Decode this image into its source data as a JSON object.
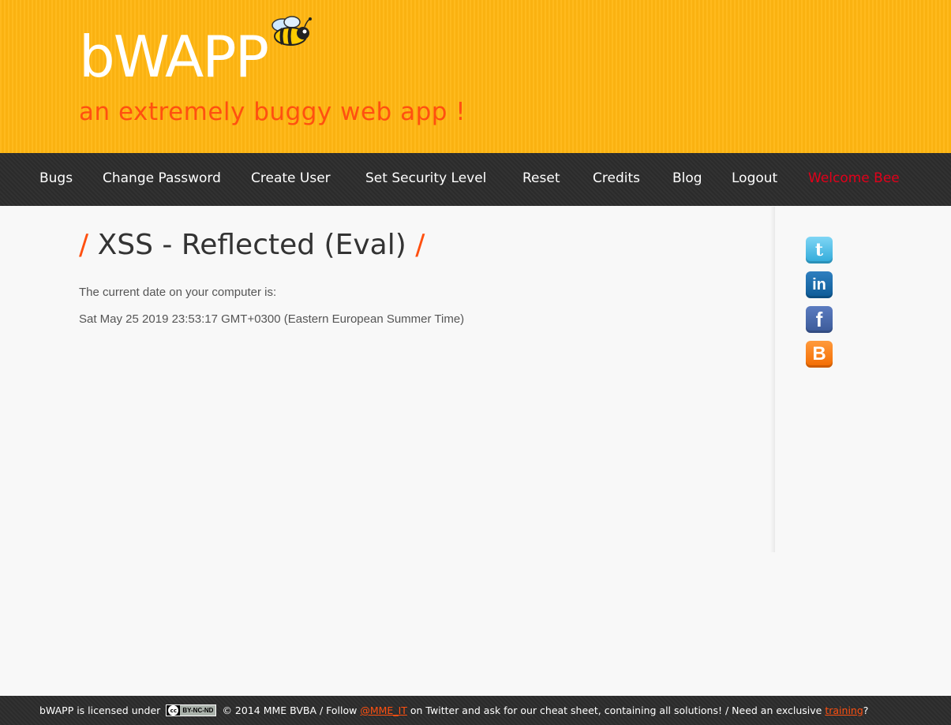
{
  "header": {
    "logo": "bWAPP",
    "tagline": "an extremely buggy web app !"
  },
  "nav": {
    "items": [
      "Bugs",
      "Change Password",
      "Create User",
      "Set Security Level",
      "Reset",
      "Credits",
      "Blog",
      "Logout",
      "Welcome Bee"
    ]
  },
  "main": {
    "title_slash_left": "/",
    "title": "XSS - Reflected (Eval)",
    "title_slash_right": "/",
    "line1": "The current date on your computer is:",
    "line2": "Sat May 25 2019 23:53:17 GMT+0300 (Eastern European Summer Time)"
  },
  "social": {
    "icons": [
      "twitter-icon",
      "linkedin-icon",
      "facebook-icon",
      "blogger-icon"
    ]
  },
  "footer": {
    "part1": "bWAPP is licensed under",
    "cc_symbol": "cc",
    "cc_label": "BY-NC-ND",
    "part2": "© 2014 MME BVBA / Follow",
    "twitter_handle": "@MME_IT",
    "part3": "on Twitter and ask for our cheat sheet, containing all solutions! / Need an exclusive",
    "training_link": "training",
    "part4": "?"
  },
  "colors": {
    "header_bg": "#ffb611",
    "accent": "#ff5010",
    "nav_bg": "#2d2d2d",
    "welcome": "#e2001a"
  }
}
